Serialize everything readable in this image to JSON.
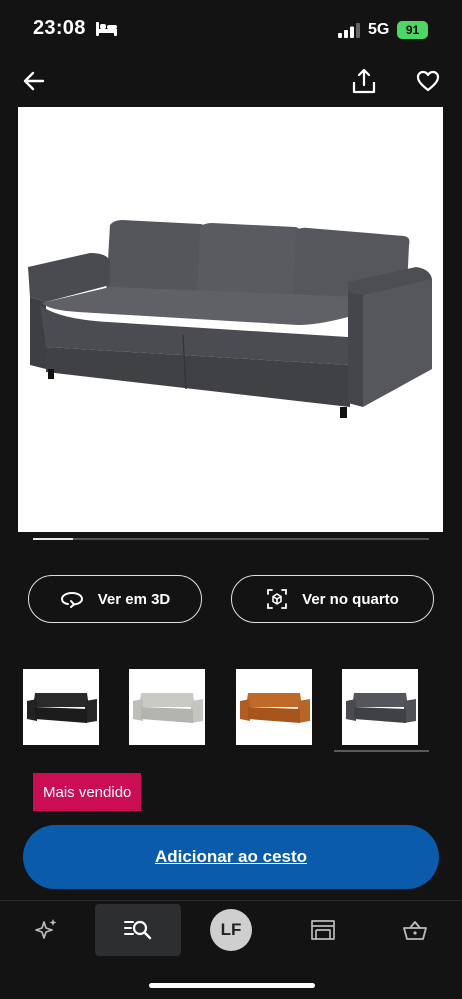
{
  "status_bar": {
    "time": "23:08",
    "network": "5G",
    "battery": "91"
  },
  "top_nav": {
    "back_icon": "arrow-left-icon",
    "share_icon": "share-icon",
    "favorite_icon": "heart-icon"
  },
  "gallery": {
    "progress": 0.1
  },
  "view_buttons": {
    "view_3d": "Ver em 3D",
    "view_room": "Ver no quarto"
  },
  "variants": [
    {
      "color": "#2a2a2a",
      "name": "black"
    },
    {
      "color": "#c9c9c6",
      "name": "light-grey"
    },
    {
      "color": "#c06a2a",
      "name": "orange-brown"
    },
    {
      "color": "#4a4b4f",
      "name": "dark-grey"
    }
  ],
  "badge": {
    "label": "Mais vendido",
    "color": "#cc0d54"
  },
  "cart_button": {
    "label": "Adicionar ao cesto",
    "color": "#0a5bab"
  },
  "bottom_nav": {
    "avatar_initials": "LF",
    "tabs": [
      "sparkle-icon",
      "search-list-icon",
      "profile-avatar",
      "store-icon",
      "basket-icon"
    ]
  }
}
